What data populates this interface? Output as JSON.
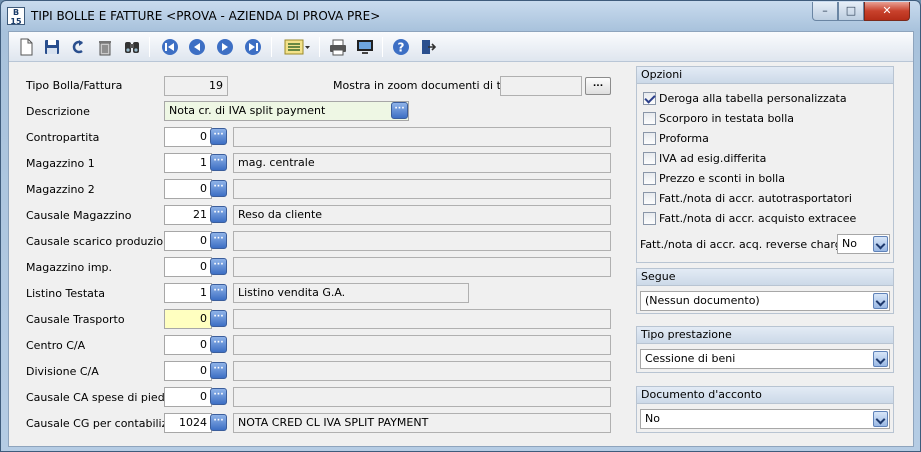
{
  "window": {
    "icon_top": "B",
    "icon_bottom": "15",
    "title": "TIPI BOLLE E FATTURE <PROVA - AZIENDA DI PROVA PRE>",
    "minimize": "–",
    "maximize": "□",
    "close": "✕"
  },
  "toolbar": {
    "icons": [
      "new-document-icon",
      "save-icon",
      "undo-icon",
      "delete-icon",
      "search-icon",
      "first-record-icon",
      "previous-record-icon",
      "next-record-icon",
      "last-record-icon",
      "list-options-icon",
      "print-icon",
      "preview-icon",
      "help-icon",
      "exit-icon"
    ]
  },
  "form": {
    "tipo_label": "Tipo Bolla/Fattura",
    "tipo_value": "19",
    "mostra_label": "Mostra in zoom documenti di tipo",
    "mostra_value": "",
    "mostra_btn": "...",
    "descrizione_label": "Descrizione",
    "descrizione_value": "Nota cr. di IVA split payment",
    "rows": [
      {
        "label": "Contropartita",
        "value": "0",
        "desc": ""
      },
      {
        "label": "Magazzino 1",
        "value": "1",
        "desc": "mag. centrale"
      },
      {
        "label": "Magazzino 2",
        "value": "0",
        "desc": ""
      },
      {
        "label": "Causale Magazzino",
        "value": "21",
        "desc": "Reso da cliente"
      },
      {
        "label": "Causale scarico produzione",
        "value": "0",
        "desc": ""
      },
      {
        "label": "Magazzino imp.",
        "value": "0",
        "desc": ""
      },
      {
        "label": "Listino Testata",
        "value": "1",
        "desc": "Listino vendita G.A."
      },
      {
        "label": "Causale Trasporto",
        "value": "0",
        "desc": ""
      },
      {
        "label": "Centro C/A",
        "value": "0",
        "desc": ""
      },
      {
        "label": "Divisione C/A",
        "value": "0",
        "desc": ""
      },
      {
        "label": "Causale CA spese di piede",
        "value": "0",
        "desc": ""
      },
      {
        "label": "Causale CG per contabilizz.",
        "value": "1024",
        "desc": "NOTA CRED CL IVA SPLIT PAYMENT"
      }
    ]
  },
  "opzioni": {
    "title": "Opzioni",
    "checks": [
      {
        "label": "Deroga alla tabella personalizzata",
        "checked": true
      },
      {
        "label": "Scorporo in testata bolla",
        "checked": false
      },
      {
        "label": "Proforma",
        "checked": false
      },
      {
        "label": "IVA ad esig.differita",
        "checked": false
      },
      {
        "label": "Prezzo e sconti in bolla",
        "checked": false
      },
      {
        "label": "Fatt./nota di accr. autotrasportatori",
        "checked": false
      },
      {
        "label": "Fatt./nota di accr. acquisto extracee",
        "checked": false
      }
    ],
    "reverse_label": "Fatt./nota di accr. acq. reverse charge",
    "reverse_value": "No"
  },
  "segue": {
    "title": "Segue",
    "value": "(Nessun documento)"
  },
  "tipo_prestazione": {
    "title": "Tipo prestazione",
    "value": "Cessione di beni"
  },
  "documento_acconto": {
    "title": "Documento d'acconto",
    "value": "No"
  }
}
